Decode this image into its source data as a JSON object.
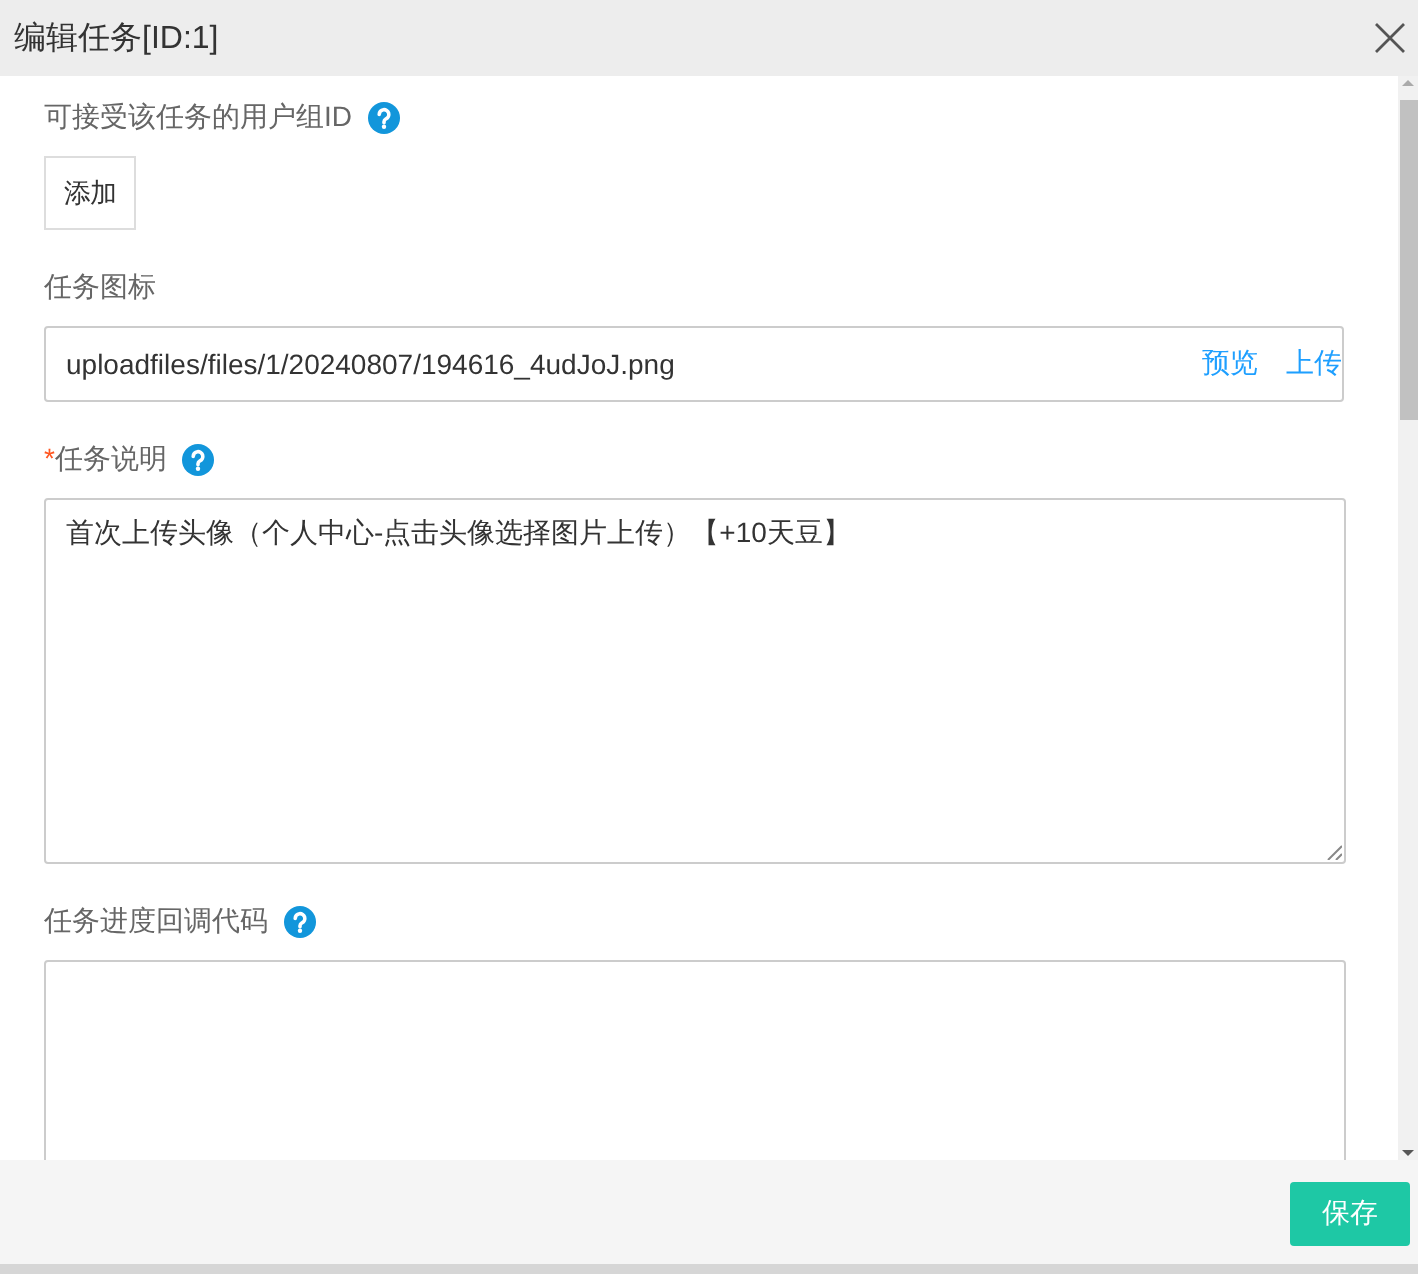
{
  "window": {
    "title": "编辑任务[ID:1]"
  },
  "fields": [
    {
      "kind": "button-list",
      "label": "可接受该任务的用户组ID",
      "help": true,
      "button": "添加"
    },
    {
      "kind": "upload",
      "label": "任务图标",
      "help": false,
      "value": "uploadfiles/files/1/20240807/194616_4udJoJ.png",
      "actions": [
        "预览",
        "上传"
      ]
    },
    {
      "kind": "textarea",
      "label": "任务说明",
      "required_mark": "*",
      "help": true,
      "value": "首次上传头像（个人中心-点击头像选择图片上传）【+10天豆】"
    },
    {
      "kind": "code",
      "label": "任务进度回调代码",
      "help": true
    }
  ],
  "footer": {
    "save_button": "保存"
  }
}
